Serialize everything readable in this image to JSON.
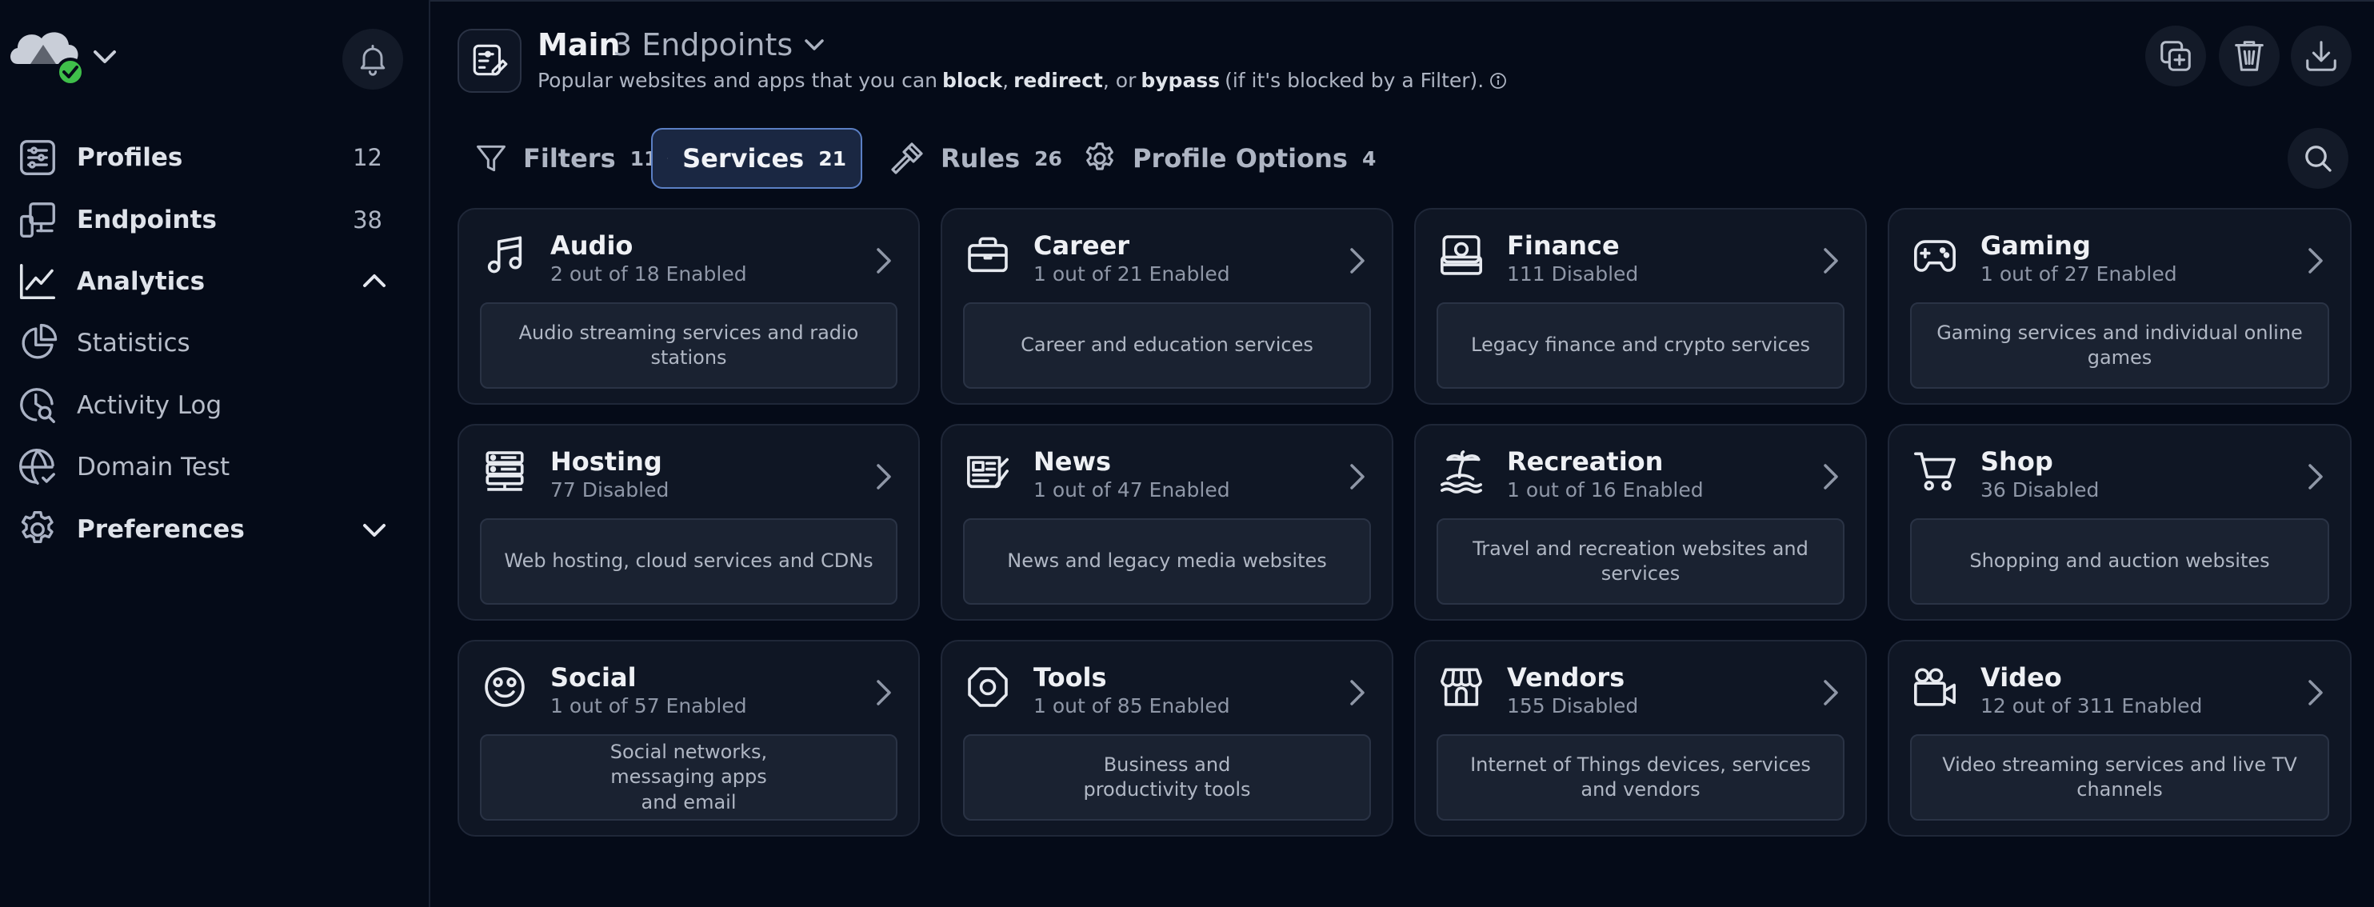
{
  "sidebar": {
    "logo_icon": "cloud-shield-logo",
    "status_icon": "check-badge-icon",
    "items": [
      {
        "label": "Profiles",
        "count": "12",
        "icon": "sliders-icon"
      },
      {
        "label": "Endpoints",
        "count": "38",
        "icon": "devices-icon"
      },
      {
        "label": "Analytics",
        "icon": "line-chart-icon"
      },
      {
        "label": "Statistics",
        "icon": "pie-chart-icon"
      },
      {
        "label": "Activity Log",
        "icon": "search-log-icon"
      },
      {
        "label": "Domain Test",
        "icon": "globe-check-icon"
      },
      {
        "label": "Preferences",
        "icon": "gear-icon"
      }
    ]
  },
  "header": {
    "title": "Main",
    "endpoints": "3 Endpoints",
    "desc_pre": "Popular websites and apps that you can",
    "desc_block": "block",
    "desc_comma": ",",
    "desc_redirect": "redirect",
    "desc_or": ", or",
    "desc_bypass": "bypass",
    "desc_post": "(if it's blocked by a Filter)."
  },
  "tabs": [
    {
      "label": "Filters",
      "count": "11"
    },
    {
      "label": "Services",
      "count": "21"
    },
    {
      "label": "Rules",
      "count": "26"
    },
    {
      "label": "Profile Options",
      "count": "4"
    }
  ],
  "cards": [
    {
      "name": "Audio",
      "status": "2 out of 18 Enabled",
      "desc": "Audio streaming services and radio stations",
      "icon": "music-note-icon"
    },
    {
      "name": "Career",
      "status": "1 out of 21 Enabled",
      "desc": "Career and education services",
      "icon": "briefcase-icon"
    },
    {
      "name": "Finance",
      "status": "111 Disabled",
      "desc": "Legacy finance and crypto services",
      "icon": "bank-card-icon"
    },
    {
      "name": "Gaming",
      "status": "1 out of 27 Enabled",
      "desc": "Gaming services and individual online games",
      "icon": "gamepad-icon"
    },
    {
      "name": "Hosting",
      "status": "77 Disabled",
      "desc": "Web hosting, cloud services and CDNs",
      "icon": "server-icon"
    },
    {
      "name": "News",
      "status": "1 out of 47 Enabled",
      "desc": "News and legacy media websites",
      "icon": "newspaper-icon"
    },
    {
      "name": "Recreation",
      "status": "1 out of 16 Enabled",
      "desc": "Travel and recreation websites and services",
      "icon": "island-icon"
    },
    {
      "name": "Shop",
      "status": "36 Disabled",
      "desc": "Shopping and auction websites",
      "icon": "cart-icon"
    },
    {
      "name": "Social",
      "status": "1 out of 57 Enabled",
      "desc": "Social networks, messaging apps and email",
      "icon": "smiley-icon"
    },
    {
      "name": "Tools",
      "status": "1 out of 85 Enabled",
      "desc": "Business and productivity tools",
      "icon": "octagon-icon"
    },
    {
      "name": "Vendors",
      "status": "155 Disabled",
      "desc": "Internet of Things devices, services and vendors",
      "icon": "storefront-icon"
    },
    {
      "name": "Video",
      "status": "12 out of 311 Enabled",
      "desc": "Video streaming services and live TV channels",
      "icon": "video-camera-icon"
    }
  ],
  "colors": {
    "background": "#050b18",
    "card": "#0f1624",
    "accent_border": "#5b7fc4",
    "status_green": "#3fbf4a"
  }
}
